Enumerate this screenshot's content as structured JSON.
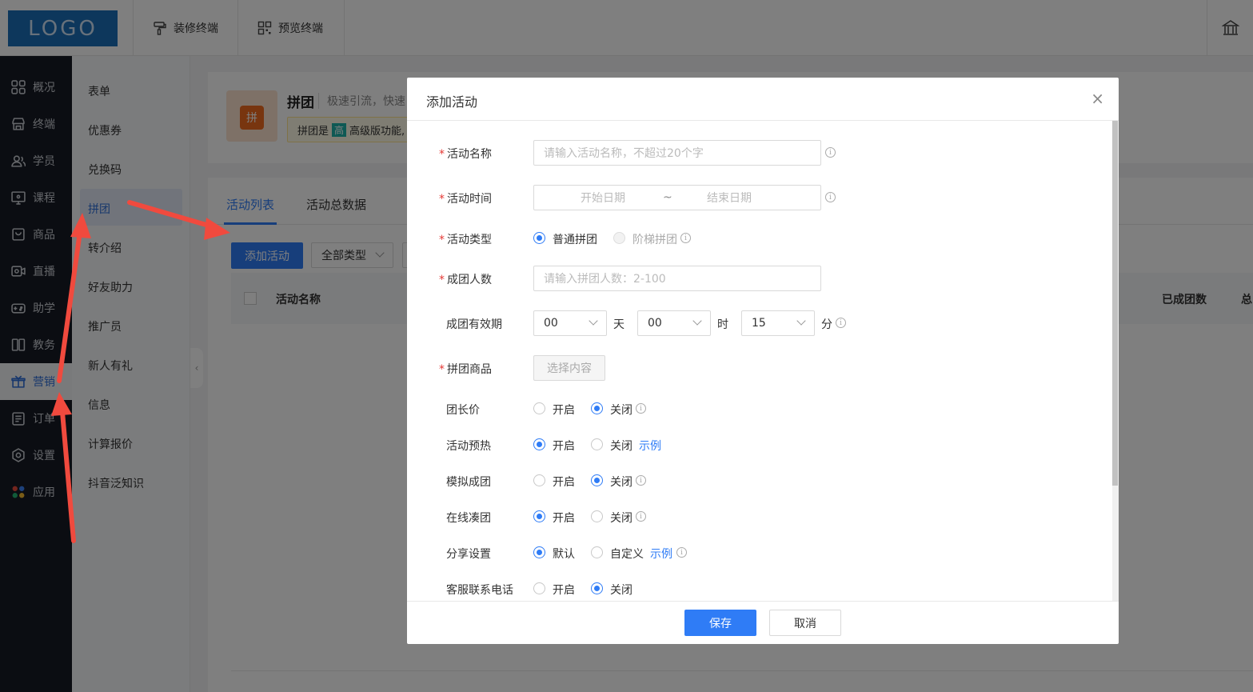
{
  "topbar": {
    "logo": "LOGO",
    "nav": [
      "装修终端",
      "预览终端"
    ]
  },
  "sidebar": {
    "items": [
      {
        "label": "概况",
        "icon": "grid-icon"
      },
      {
        "label": "终端",
        "icon": "store-icon"
      },
      {
        "label": "学员",
        "icon": "users-icon"
      },
      {
        "label": "课程",
        "icon": "monitor-icon"
      },
      {
        "label": "商品",
        "icon": "bag-icon"
      },
      {
        "label": "直播",
        "icon": "video-icon"
      },
      {
        "label": "助学",
        "icon": "gamepad-icon"
      },
      {
        "label": "教务",
        "icon": "book-icon"
      },
      {
        "label": "营销",
        "icon": "gift-icon",
        "active": true
      },
      {
        "label": "订单",
        "icon": "clipboard-icon"
      },
      {
        "label": "设置",
        "icon": "settings-icon"
      },
      {
        "label": "应用",
        "icon": "apps-icon"
      }
    ]
  },
  "submenu": {
    "items": [
      "表单",
      "优惠券",
      "兑换码",
      "拼团",
      "转介绍",
      "好友助力",
      "推广员",
      "新人有礼",
      "信息",
      "计算报价",
      "抖音泛知识"
    ],
    "active": "拼团"
  },
  "page": {
    "feature_icon_text": "拼",
    "title": "拼团",
    "subtitle": "极速引流，快速",
    "notice_prefix": "拼团是",
    "notice_badge": "高",
    "notice_text": "高级版功能,",
    "tabs": [
      "活动列表",
      "活动总数据"
    ],
    "add_button": "添加活动",
    "type_filter": "全部类型",
    "table_headers": [
      "活动名称",
      "已成团数",
      "总"
    ]
  },
  "modal": {
    "title": "添加活动",
    "close": "×",
    "fields": {
      "name_label": "活动名称",
      "name_placeholder": "请输入活动名称，不超过20个字",
      "time_label": "活动时间",
      "start_placeholder": "开始日期",
      "range_sep": "~",
      "end_placeholder": "结束日期",
      "type_label": "活动类型",
      "type_opt1": "普通拼团",
      "type_opt2": "阶梯拼团",
      "size_label": "成团人数",
      "size_placeholder": "请输入拼团人数：2-100",
      "validity_label": "成团有效期",
      "days": "00",
      "days_unit": "天",
      "hours": "00",
      "hours_unit": "时",
      "minutes": "15",
      "minutes_unit": "分",
      "product_label": "拼团商品",
      "product_button": "选择内容",
      "leader_label": "团长价",
      "warmup_label": "活动预热",
      "simulate_label": "模拟成团",
      "online_label": "在线凑团",
      "share_label": "分享设置",
      "phone_label": "客服联系电话",
      "on": "开启",
      "off": "关闭",
      "default": "默认",
      "custom": "自定义",
      "example": "示例"
    },
    "save": "保存",
    "cancel": "取消"
  },
  "colors": {
    "accent": "#2f7cf6",
    "sidebar_bg": "#161a24",
    "annotation_arrow": "#f04a3e"
  }
}
